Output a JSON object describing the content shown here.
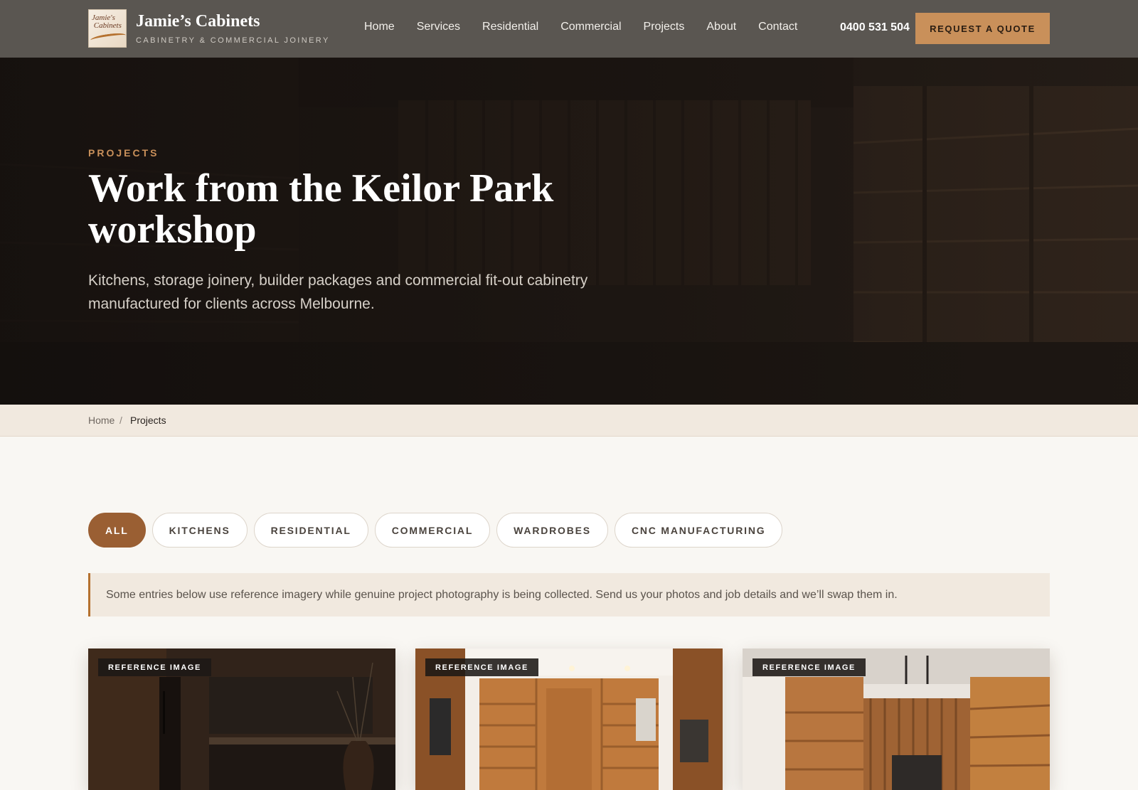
{
  "brand": {
    "name": "Jamie’s Cabinets",
    "tagline": "CABINETRY & COMMERCIAL JOINERY",
    "logo_text": "Jamie's Cabinets"
  },
  "nav": {
    "links": [
      "Home",
      "Services",
      "Residential",
      "Commercial",
      "Projects",
      "About",
      "Contact"
    ],
    "phone": "0400 531 504",
    "cta": "REQUEST A QUOTE"
  },
  "hero": {
    "eyebrow": "PROJECTS",
    "title": "Work from the Keilor Park workshop",
    "subtitle": "Kitchens, storage joinery, builder packages and commercial fit-out cabinetry manufactured for clients across Melbourne."
  },
  "breadcrumb": {
    "home": "Home",
    "separator": "/",
    "current": "Projects"
  },
  "filters": {
    "items": [
      "ALL",
      "KITCHENS",
      "RESIDENTIAL",
      "COMMERCIAL",
      "WARDROBES",
      "CNC MANUFACTURING"
    ],
    "active": "ALL"
  },
  "notice": "Some entries below use reference imagery while genuine project photography is being collected. Send us your photos and job details and we’ll swap them in.",
  "cards": [
    {
      "badge": "REFERENCE IMAGE",
      "scene": "dark-kitchen"
    },
    {
      "badge": "REFERENCE IMAGE",
      "scene": "walk-in-wardrobe"
    },
    {
      "badge": "REFERENCE IMAGE",
      "scene": "retail-shelving"
    }
  ],
  "colors": {
    "nav_bg": "#5a5651",
    "accent": "#c9905a",
    "active_pill": "#9a5f33",
    "crumb_bg": "#f1e9df"
  }
}
